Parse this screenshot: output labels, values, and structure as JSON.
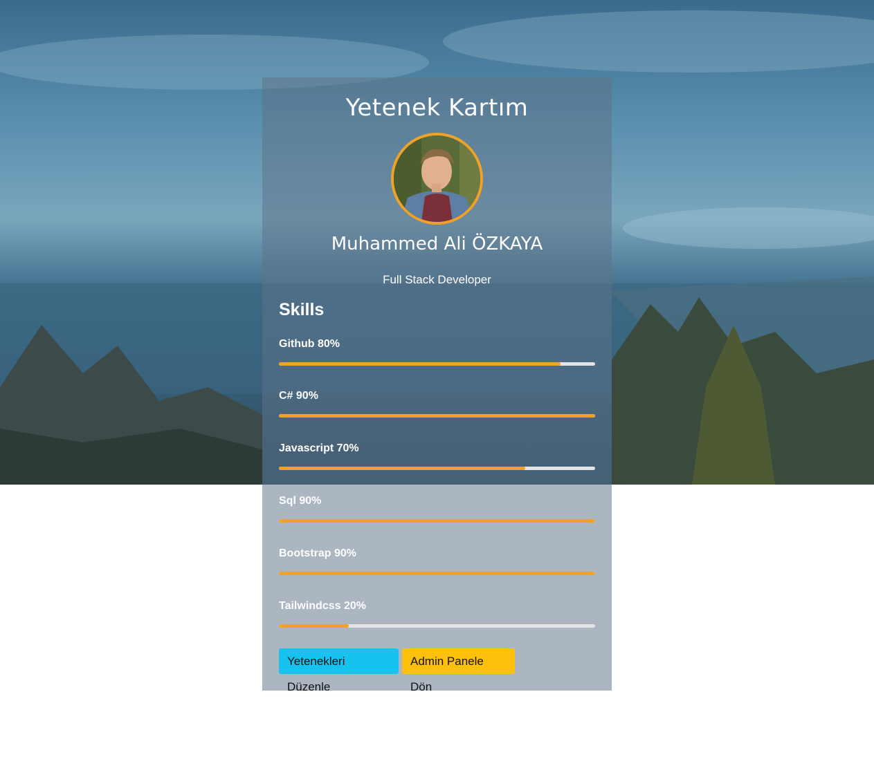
{
  "card": {
    "title": "Yetenek Kartım",
    "name": "Muhammed Ali ÖZKAYA",
    "role": "Full Stack Developer"
  },
  "skills_section": {
    "title": "Skills",
    "items": [
      {
        "label": "Github 80%",
        "percent": 89
      },
      {
        "label": "C# 90%",
        "percent": 100
      },
      {
        "label": "Javascript 70%",
        "percent": 78
      },
      {
        "label": "Sql 90%",
        "percent": 100
      },
      {
        "label": "Bootstrap 90%",
        "percent": 100
      },
      {
        "label": "Tailwindcss 20%",
        "percent": 22
      }
    ]
  },
  "buttons": {
    "edit_label": "Yetenekleri Düzenle",
    "admin_label": "Admin Panele Dön"
  },
  "colors": {
    "accent": "#f0a127",
    "edit_button": "#17c2ee",
    "admin_button": "#fdc10d"
  }
}
